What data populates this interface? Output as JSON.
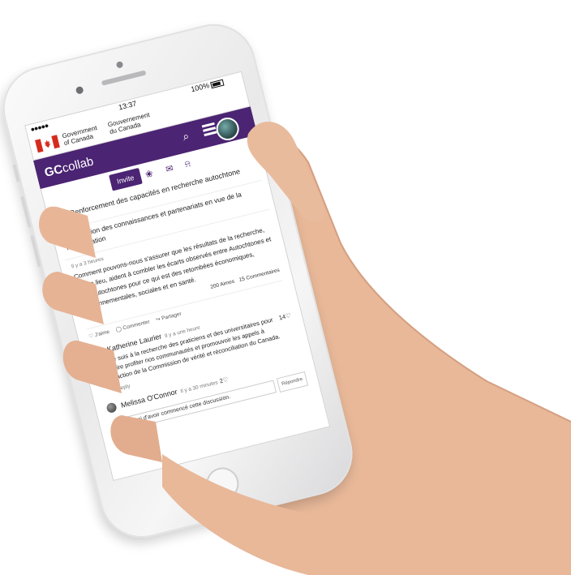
{
  "status_bar": {
    "signal": "●●●●● ",
    "time": "13:37",
    "battery": "100%"
  },
  "government": {
    "english": [
      "Government",
      "of Canada"
    ],
    "french": [
      "Gouvernement",
      "du Canada"
    ]
  },
  "nav": {
    "brand_bold": "GC",
    "brand_thin": "collab"
  },
  "subnav": {
    "invite_label": "Invite"
  },
  "group": {
    "title": "Renforcement des capacités en recherche autochtone",
    "subtitle": "Mobilisation des connaissances et partenariats en vue de la reconciliation"
  },
  "post": {
    "time": "Il y a 3 heures",
    "text": "Comment pouvons-nous s'assurer que les résultats de la recherche, s'il y a lieu, aident à combler les écarts observés entre Autochtones et non-Autochtones pour ce qui est des retombées économiques, environnementales, sociales et en santé.",
    "likes": "200 Aimes",
    "comments": "15 Commentaires",
    "action_like": "J'aime",
    "action_comment": "Commenter",
    "action_share": "Partager"
  },
  "comments": [
    {
      "name": "Katherine Laurier",
      "time": "Il y a une heure",
      "text": "Je suis à la recherche des praticiens et des universitaires pour faire profiter nos communautés et promouvoir les appels à l'action de la Commission de vérité et réconciliation du Canada.",
      "likes": "14♡",
      "reply": "Reply"
    },
    {
      "name": "Melissa O'Connor",
      "time": "Il y a 30 minutes",
      "text": "Merci d'avoir commencé cette discussion.",
      "likes": "2♡",
      "reply_button": "Répondre"
    }
  ],
  "colors": {
    "brand_purple": "#4b2473",
    "flag_red": "#d52b1e"
  },
  "icons": [
    "search-icon",
    "menu-icon",
    "people-icon",
    "mail-icon",
    "bell-icon",
    "heart-icon",
    "comment-icon",
    "share-icon"
  ]
}
